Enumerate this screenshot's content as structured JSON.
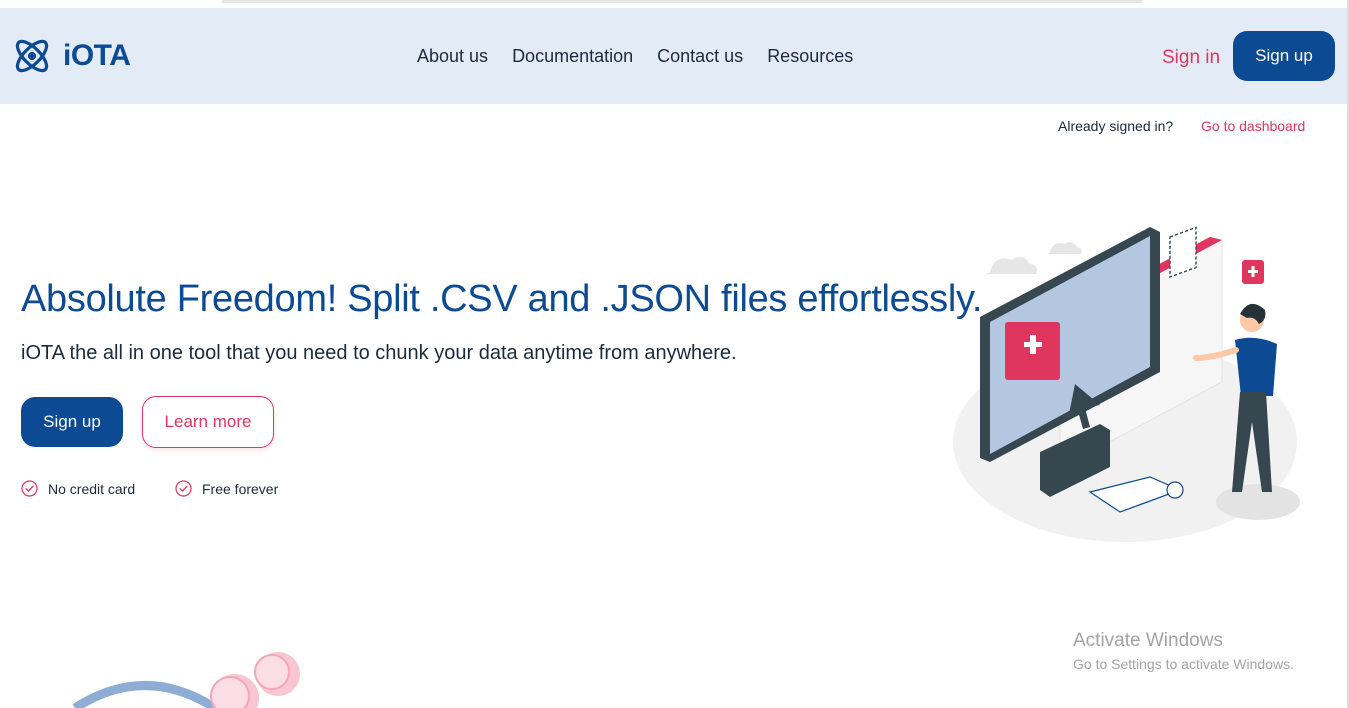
{
  "header": {
    "logo_text": "iOTA",
    "nav": [
      "About us",
      "Documentation",
      "Contact us",
      "Resources"
    ],
    "sign_in": "Sign in",
    "sign_up": "Sign up"
  },
  "signed_in_bar": {
    "prompt": "Already signed in?",
    "link": "Go to dashboard"
  },
  "hero": {
    "title": "Absolute Freedom! Split .CSV and .JSON files effortlessly.",
    "subtitle": "iOTA the all in one tool that you need to chunk your data anytime from anywhere.",
    "primary_button": "Sign up",
    "secondary_button": "Learn more",
    "features": [
      "No credit card",
      "Free forever"
    ]
  },
  "watermark": {
    "line1": "Activate Windows",
    "line2": "Go to Settings to activate Windows."
  },
  "colors": {
    "brand_blue": "#0c4a93",
    "accent_pink": "#e0355f",
    "header_bg": "#e3ecf6"
  },
  "icons": [
    "iota-logo-icon",
    "check-circle-icon",
    "hero-illustration",
    "media-illustration"
  ]
}
